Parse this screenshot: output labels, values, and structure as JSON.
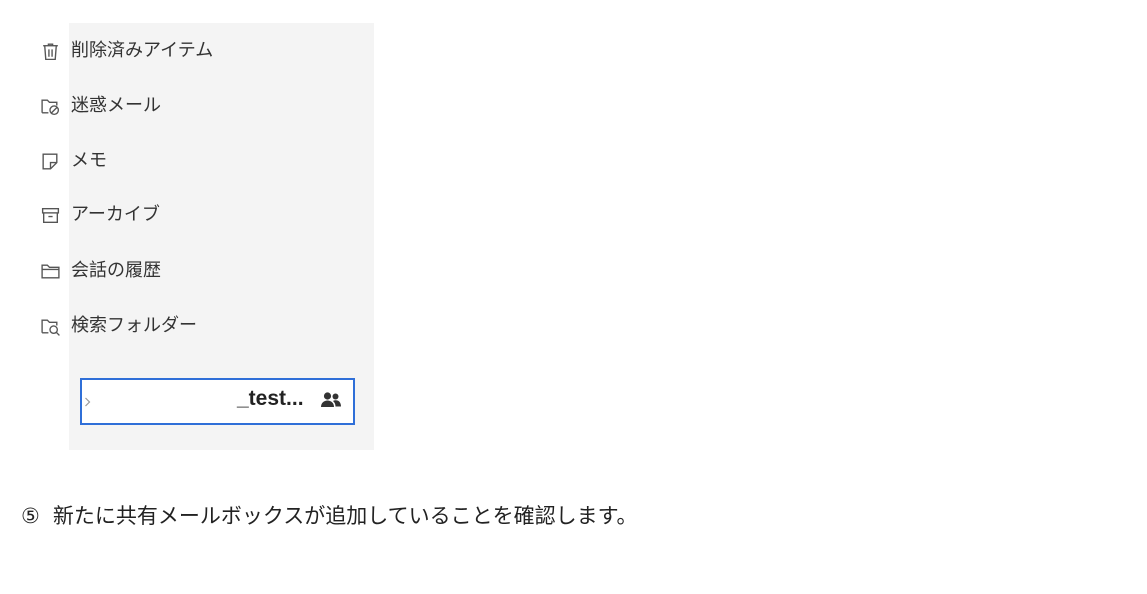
{
  "colors": {
    "panel_background": "#f4f4f4",
    "selection_border": "#2f6fd8",
    "icon_stroke": "#555555",
    "text": "#222222"
  },
  "folders": [
    {
      "label": "削除済みアイテム",
      "icon": "trash-icon"
    },
    {
      "label": "迷惑メール",
      "icon": "junk-folder-icon"
    },
    {
      "label": "メモ",
      "icon": "note-icon"
    },
    {
      "label": "アーカイブ",
      "icon": "archive-icon"
    },
    {
      "label": "会話の履歴",
      "icon": "folder-icon"
    },
    {
      "label": "検索フォルダー",
      "icon": "search-folder-icon"
    }
  ],
  "shared_mailbox": {
    "name": "_test...",
    "icon": "shared-people-icon",
    "expand_icon": "chevron-right-icon",
    "selected": true
  },
  "instruction": {
    "step_number": "⑤",
    "text": "新たに共有メールボックスが追加していることを確認します。"
  }
}
